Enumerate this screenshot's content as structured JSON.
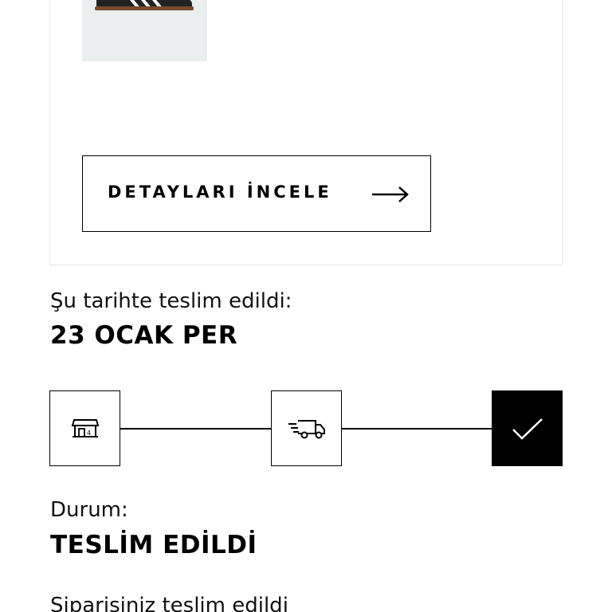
{
  "order_card": {
    "details_button_label": "DETAYLARI İNCELE"
  },
  "delivery": {
    "caption": "Şu tarihte teslim edildi:",
    "date": "23 OCAK PER"
  },
  "tracker": {
    "steps": [
      {
        "icon": "store-icon",
        "state": "completed"
      },
      {
        "icon": "delivery-truck-icon",
        "state": "completed"
      },
      {
        "icon": "checkmark-icon",
        "state": "current"
      }
    ]
  },
  "status": {
    "caption": "Durum:",
    "value": "TESLİM EDİLDİ"
  },
  "message": "Siparişiniz teslim edildi"
}
